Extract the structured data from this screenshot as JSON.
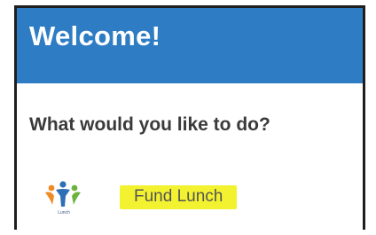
{
  "header": {
    "title": "Welcome!",
    "background_color": "#2d7cc4"
  },
  "main": {
    "question": "What would you like to do?",
    "actions": [
      {
        "icon": "lunch-program-logo-icon",
        "logo_caption": "Lunch",
        "label": "Fund Lunch",
        "highlight_color": "#f3f230"
      }
    ]
  }
}
